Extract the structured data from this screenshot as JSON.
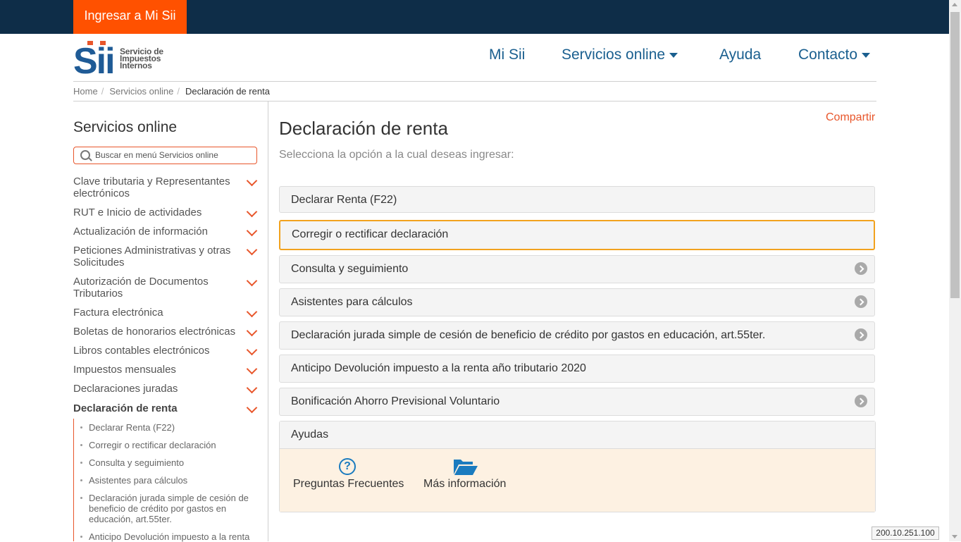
{
  "header": {
    "login_button": "Ingresar a Mi Sii",
    "logo_letters": "Sii",
    "logo_line1": "Servicio de",
    "logo_line2": "Impuestos",
    "logo_line3": "Internos",
    "nav": [
      {
        "label": "Mi Sii",
        "dropdown": false
      },
      {
        "label": "Servicios online",
        "dropdown": true
      },
      {
        "label": "Ayuda",
        "dropdown": false
      },
      {
        "label": "Contacto",
        "dropdown": true
      }
    ]
  },
  "breadcrumb": [
    "Home",
    "Servicios online",
    "Declaración de renta"
  ],
  "sidebar": {
    "title": "Servicios online",
    "search_placeholder": "Buscar en menú Servicios online",
    "items": [
      {
        "label": "Clave tributaria y Representantes electrónicos"
      },
      {
        "label": "RUT e Inicio de actividades"
      },
      {
        "label": "Actualización de información"
      },
      {
        "label": "Peticiones Administrativas y otras Solicitudes"
      },
      {
        "label": "Autorización de Documentos Tributarios"
      },
      {
        "label": "Factura electrónica"
      },
      {
        "label": "Boletas de honorarios electrónicas"
      },
      {
        "label": "Libros contables electrónicos"
      },
      {
        "label": "Impuestos mensuales"
      },
      {
        "label": "Declaraciones juradas"
      },
      {
        "label": "Declaración de renta",
        "active": true
      }
    ],
    "subitems": [
      "Declarar Renta (F22)",
      "Corregir o rectificar declaración",
      "Consulta y seguimiento",
      "Asistentes para cálculos",
      "Declaración jurada simple de cesión de beneficio de crédito por gastos en educación, art.55ter.",
      "Anticipo Devolución impuesto a la renta"
    ]
  },
  "main": {
    "title": "Declaración de renta",
    "share": "Compartir",
    "subtitle": "Selecciona la opción a la cual deseas ingresar:",
    "options": [
      {
        "label": "Declarar Renta (F22)",
        "has_arrow": false
      },
      {
        "label": "Corregir o rectificar declaración",
        "has_arrow": false,
        "focused": true
      },
      {
        "label": "Consulta y seguimiento",
        "has_arrow": true
      },
      {
        "label": "Asistentes para cálculos",
        "has_arrow": true
      },
      {
        "label": "Declaración jurada simple de cesión de beneficio de crédito por gastos en educación, art.55ter.",
        "has_arrow": true
      },
      {
        "label": "Anticipo Devolución impuesto a la renta año tributario 2020",
        "has_arrow": false
      },
      {
        "label": "Bonificación Ahorro Previsional Voluntario",
        "has_arrow": true
      }
    ],
    "help": {
      "title": "Ayudas",
      "links": [
        {
          "label": "Preguntas Frecuentes",
          "icon": "question-circle-icon",
          "glyph": "?"
        },
        {
          "label": "Más información",
          "icon": "open-folder-icon"
        }
      ]
    }
  },
  "status": {
    "ip": "200.10.251.100"
  },
  "colors": {
    "topbar": "#0e2d48",
    "accent": "#ff5100",
    "link": "#1a5f8f",
    "focus": "#f2a21e"
  }
}
